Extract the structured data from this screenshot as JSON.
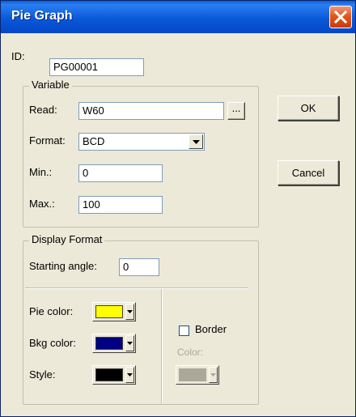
{
  "window": {
    "title": "Pie Graph"
  },
  "id_field": {
    "label": "ID:",
    "value": "PG00001"
  },
  "variable": {
    "group_title": "Variable",
    "read_label": "Read:",
    "read_value": "W60",
    "browse_label": "...",
    "format_label": "Format:",
    "format_value": "BCD",
    "min_label": "Min.:",
    "min_value": "0",
    "max_label": "Max.:",
    "max_value": "100"
  },
  "buttons": {
    "ok": "OK",
    "cancel": "Cancel"
  },
  "display_format": {
    "group_title": "Display Format",
    "starting_angle_label": "Starting angle:",
    "starting_angle_value": "0",
    "pie_color_label": "Pie color:",
    "pie_color": "#ffff00",
    "bkg_color_label": "Bkg color:",
    "bkg_color": "#000080",
    "style_label": "Style:",
    "style_color": "#000000",
    "border_label": "Border",
    "border_checked": false,
    "border_color_label": "Color:",
    "border_color": "#aca899"
  },
  "icons": {
    "close": "close-icon",
    "dropdown": "chevron-down-icon"
  }
}
